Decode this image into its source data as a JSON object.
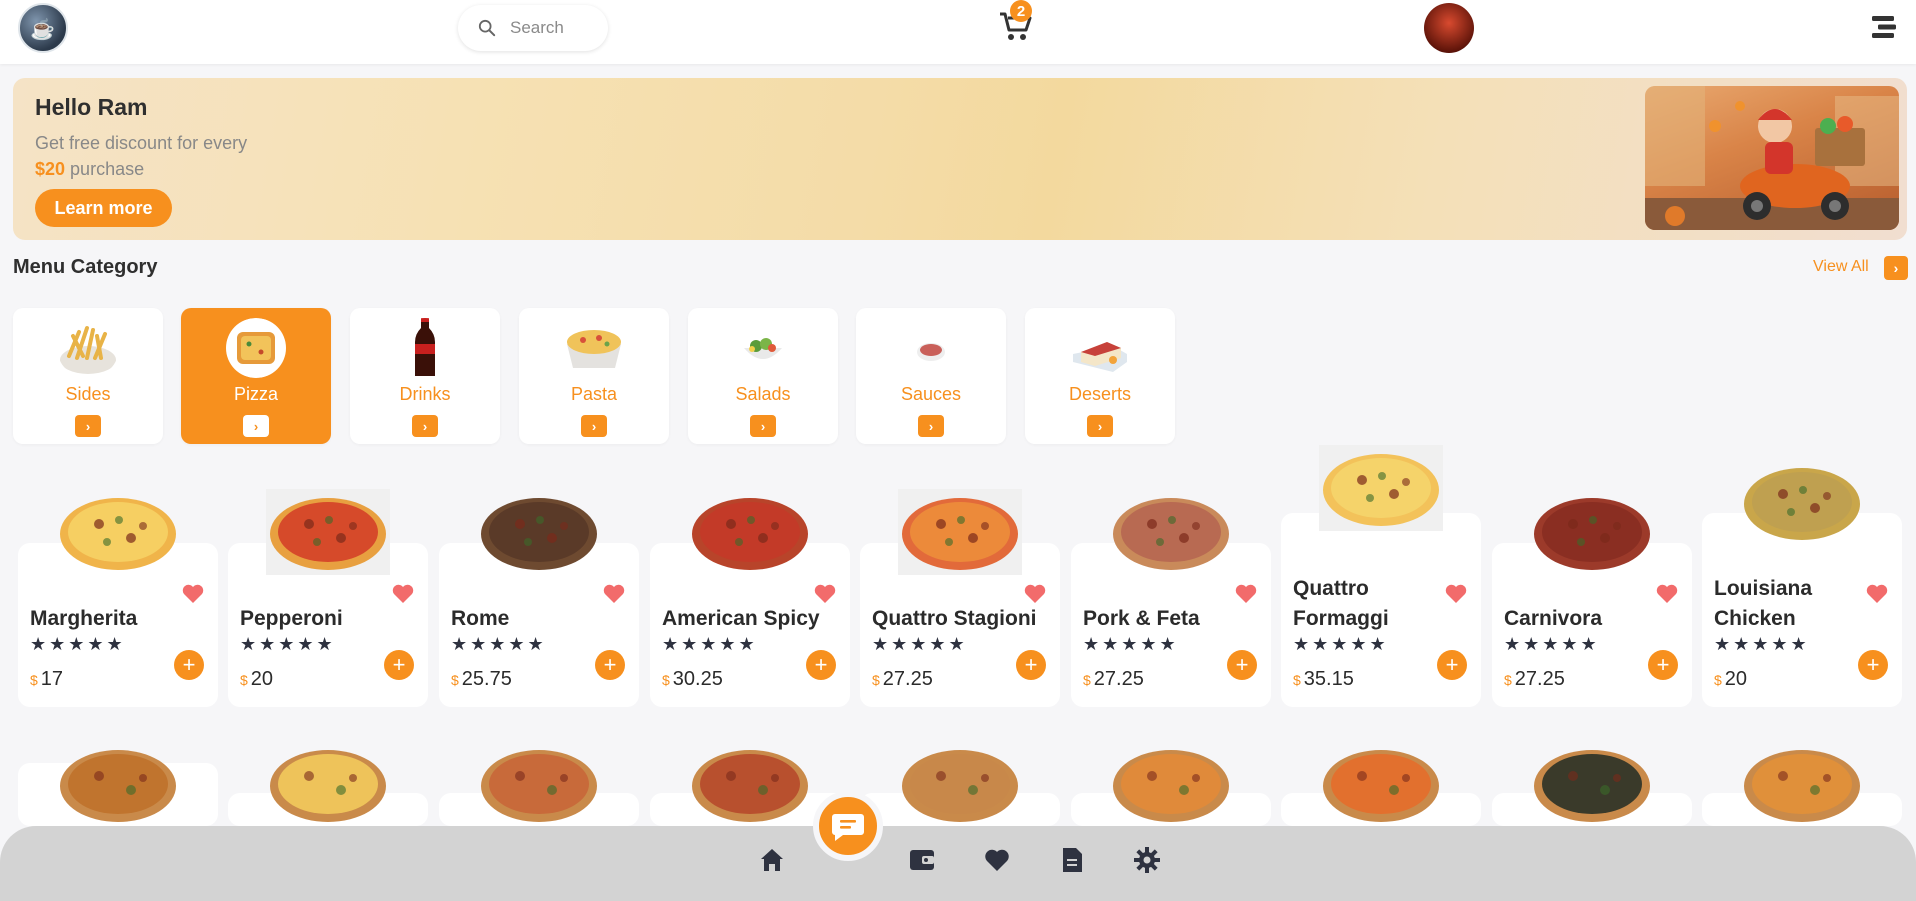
{
  "header": {
    "search_placeholder": "Search",
    "cart_count": "2"
  },
  "banner": {
    "title": "Hello Ram",
    "text_line1": "Get free discount for every",
    "amount": "$20",
    "text_line2": " purchase",
    "button": "Learn more"
  },
  "category_section": {
    "title": "Menu Category",
    "view_all": "View All"
  },
  "categories": [
    {
      "label": "Sides",
      "active": false
    },
    {
      "label": "Pizza",
      "active": true
    },
    {
      "label": "Drinks",
      "active": false
    },
    {
      "label": "Pasta",
      "active": false
    },
    {
      "label": "Salads",
      "active": false
    },
    {
      "label": "Sauces",
      "active": false
    },
    {
      "label": "Deserts",
      "active": false
    }
  ],
  "products": [
    {
      "name": "Margherita",
      "price": "17",
      "currency": "$"
    },
    {
      "name": "Pepperoni",
      "price": "20",
      "currency": "$"
    },
    {
      "name": "Rome",
      "price": "25.75",
      "currency": "$"
    },
    {
      "name": "American Spicy",
      "price": "30.25",
      "currency": "$"
    },
    {
      "name": "Quattro Stagioni",
      "price": "27.25",
      "currency": "$"
    },
    {
      "name": "Pork & Feta",
      "price": "27.25",
      "currency": "$"
    },
    {
      "name": "Quattro Formaggi",
      "price": "35.15",
      "currency": "$"
    },
    {
      "name": "Carnivora",
      "price": "27.25",
      "currency": "$"
    },
    {
      "name": "Louisiana Chicken",
      "price": "20",
      "currency": "$"
    }
  ],
  "rating_stars": "★★★★★",
  "colors": {
    "accent": "#f7901e",
    "heart": "#f26b6b",
    "bottom_nav": "#d3d3d3"
  },
  "icons": {
    "logo": "logo-icon",
    "search": "search-icon",
    "cart": "cart-icon",
    "menu": "menu-icon",
    "heart": "heart-icon",
    "add": "plus-icon",
    "chat": "chat-icon",
    "home": "home-icon",
    "wallet": "wallet-icon",
    "favorites": "heart-icon",
    "orders": "receipt-icon",
    "settings": "gear-icon"
  }
}
